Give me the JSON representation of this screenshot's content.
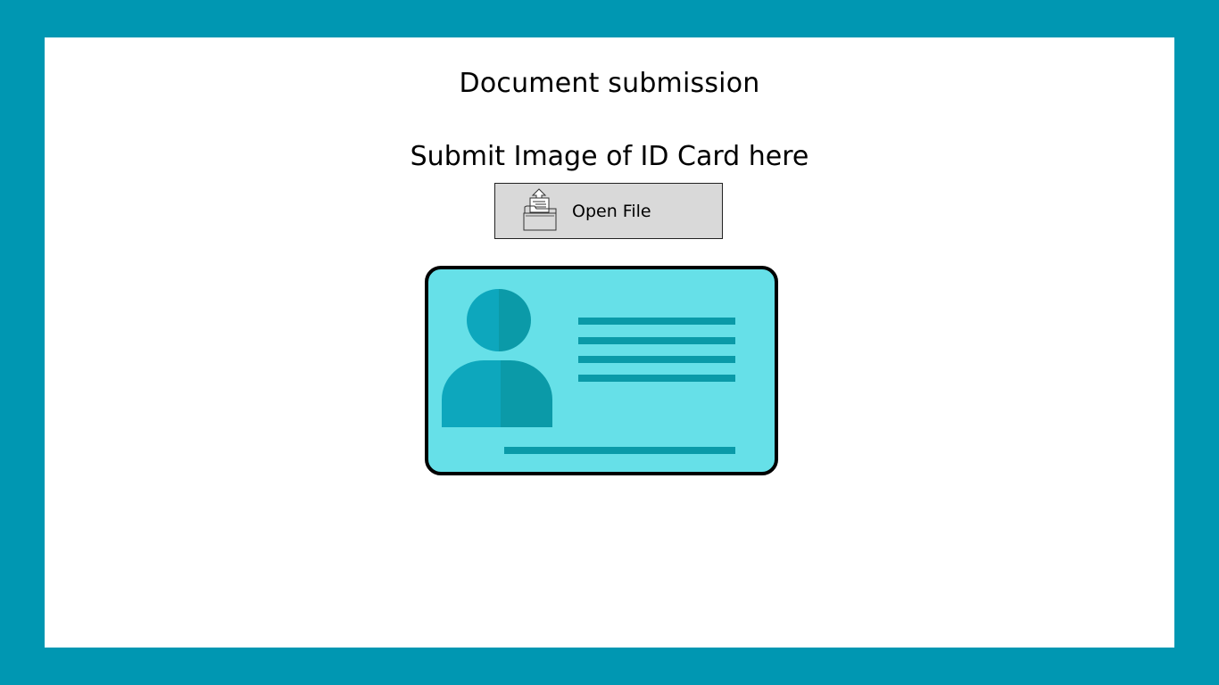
{
  "page": {
    "title": "Document submission",
    "subtitle": "Submit Image of ID Card here"
  },
  "open_file_button": {
    "label": "Open File",
    "icon": "folder-upload-icon"
  },
  "id_card_illustration": {
    "icon": "id-card-icon"
  },
  "colors": {
    "frame": "#0097b2",
    "panel": "#ffffff",
    "card_fill": "#66e0e8",
    "card_accent": "#0a9aa8",
    "avatar_light": "#0da7bd",
    "avatar_dark": "#0b9aa8",
    "button_fill": "#d9d9d9"
  }
}
